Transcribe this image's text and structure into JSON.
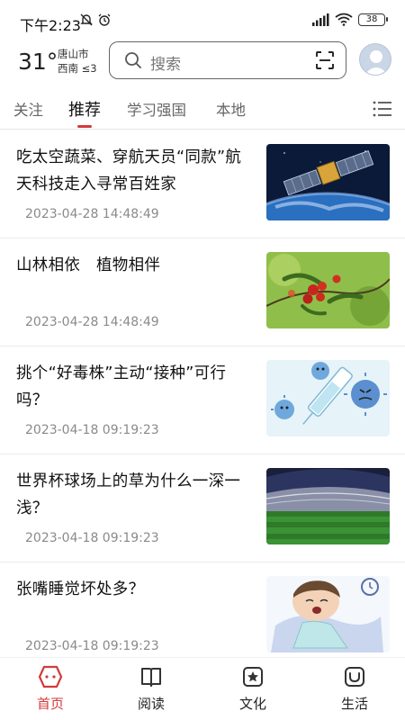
{
  "status": {
    "time": "下午2:23",
    "battery": "38"
  },
  "header": {
    "temperature": "31°",
    "city": "唐山市",
    "wind": "西南 ≤3",
    "search_placeholder": "搜索"
  },
  "tabs": [
    {
      "label": "关注"
    },
    {
      "label": "推荐"
    },
    {
      "label": "学习强国"
    },
    {
      "label": "本地"
    }
  ],
  "active_tab": "推荐",
  "news": [
    {
      "title": "吃太空蔬菜、穿航天员“同款”航天科技走入寻常百姓家",
      "date": "2023-04-28 14:48:49",
      "thumb": "satellite-earth"
    },
    {
      "title": "山林相依　植物相伴",
      "date": "2023-04-28 14:48:49",
      "thumb": "red-berries"
    },
    {
      "title": "挑个“好毒株”主动“接种”可行吗？",
      "date": "2023-04-18 09:19:23",
      "thumb": "virus-cartoon"
    },
    {
      "title": "世界杯球场上的草为什么一深一浅？",
      "date": "2023-04-18 09:19:23",
      "thumb": "stadium"
    },
    {
      "title": "张嘴睡觉坏处多？",
      "date": "2023-04-18 09:19:23",
      "thumb": "sleeping-child"
    }
  ],
  "bottom_nav": [
    {
      "label": "首页",
      "icon": "home-icon"
    },
    {
      "label": "阅读",
      "icon": "book-icon"
    },
    {
      "label": "文化",
      "icon": "culture-icon"
    },
    {
      "label": "生活",
      "icon": "life-icon"
    }
  ],
  "active_nav": "首页",
  "colors": {
    "accent": "#d23b3b",
    "text": "#111111",
    "muted": "#8a8a8a"
  }
}
